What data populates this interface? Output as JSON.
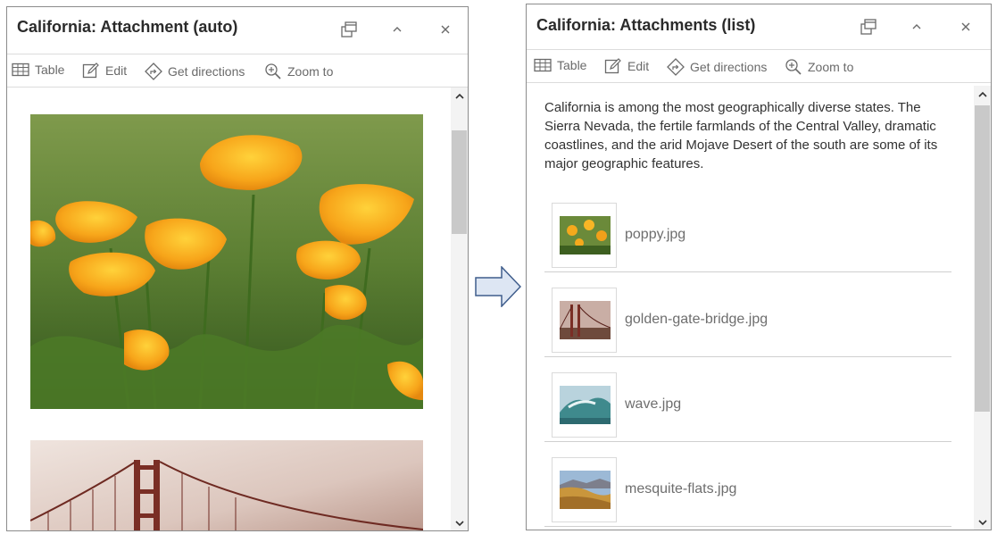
{
  "left_panel": {
    "title": "California: Attachment (auto)",
    "toolbar": {
      "table": "Table",
      "edit": "Edit",
      "directions": "Get directions",
      "zoom": "Zoom to"
    }
  },
  "right_panel": {
    "title": "California: Attachments (list)",
    "toolbar": {
      "table": "Table",
      "edit": "Edit",
      "directions": "Get directions",
      "zoom": "Zoom to"
    },
    "description": "California is among the most geographically diverse states. The Sierra Nevada, the fertile farmlands of the Central Valley, dramatic coastlines, and the arid Mojave Desert of the south are some of its major geographic features.",
    "attachments": [
      "poppy.jpg",
      "golden-gate-bridge.jpg",
      "wave.jpg",
      "mesquite-flats.jpg"
    ]
  }
}
